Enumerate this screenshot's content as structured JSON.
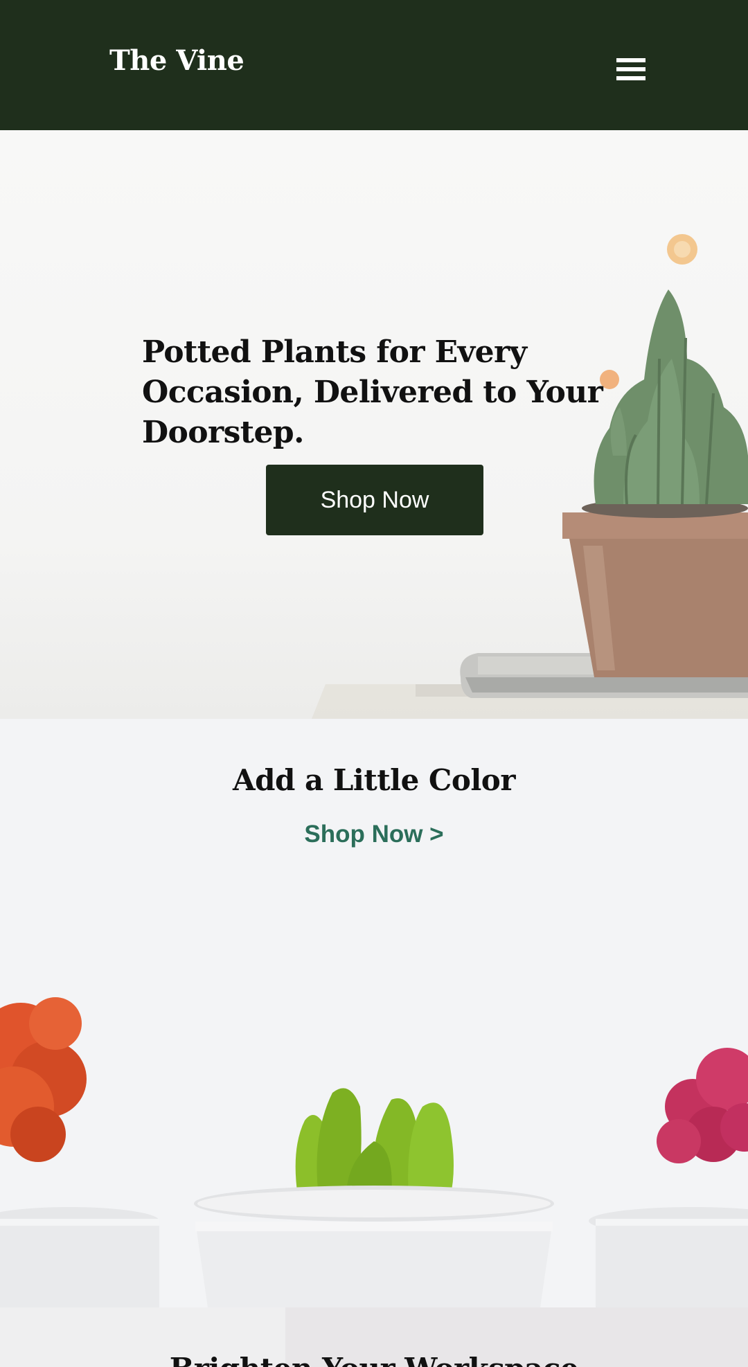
{
  "header": {
    "brand": "The Vine",
    "menu_icon": "hamburger-menu-icon",
    "background_color": "#1f2f1c"
  },
  "hero": {
    "title": "Potted Plants for Every Occasion, Delivered to Your Doorstep.",
    "button_label": "Shop Now",
    "image": "potted-cactus-on-books"
  },
  "color_section": {
    "title": "Add a Little Color",
    "link_label": "Shop Now >",
    "link_color": "#2b6e5a",
    "image": "colorful-cacti-in-white-pots"
  },
  "next_section": {
    "title": "Brighten Your Workspace"
  }
}
